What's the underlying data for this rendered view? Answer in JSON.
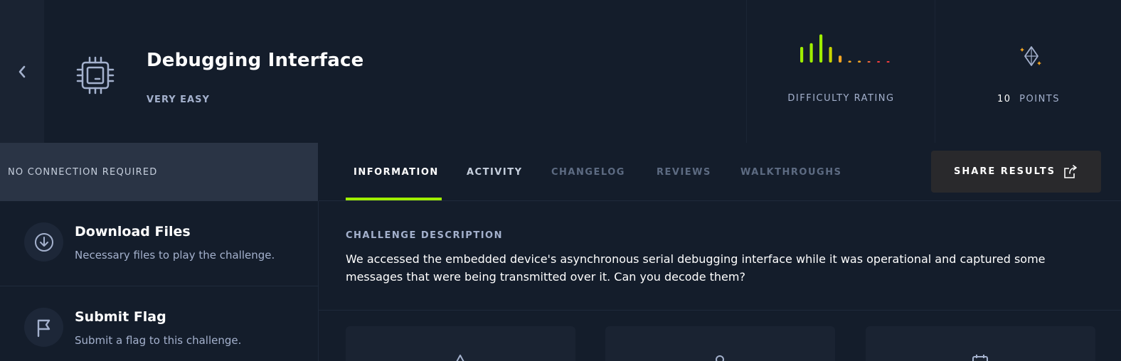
{
  "header": {
    "title": "Debugging Interface",
    "difficulty": "VERY EASY",
    "difficulty_rating_label": "DIFFICULTY RATING",
    "points_value": "10",
    "points_label": "POINTS",
    "rating_bars": [
      {
        "level": 0.5,
        "color": "#9fef00"
      },
      {
        "level": 0.62,
        "color": "#9fef00"
      },
      {
        "level": 0.9,
        "color": "#9fef00"
      },
      {
        "level": 0.5,
        "color": "#c8d400"
      },
      {
        "level": 0.22,
        "color": "#f5a623"
      },
      {
        "level": 0.06,
        "color": "#f5a623"
      },
      {
        "level": 0.06,
        "color": "#f5a623"
      },
      {
        "level": 0.04,
        "color": "#ff6a3d"
      },
      {
        "level": 0.04,
        "color": "#ff3e3e"
      },
      {
        "level": 0.04,
        "color": "#ff3e3e"
      }
    ]
  },
  "sidebar": {
    "connection": "NO CONNECTION REQUIRED",
    "download_title": "Download Files",
    "download_sub": "Necessary files to play the challenge.",
    "flag_title": "Submit Flag",
    "flag_sub": "Submit a flag to this challenge."
  },
  "tabs": {
    "information": "INFORMATION",
    "activity": "ACTIVITY",
    "changelog": "CHANGELOG",
    "reviews": "REVIEWS",
    "walkthroughs": "WALKTHROUGHS",
    "share": "SHARE RESULTS"
  },
  "content": {
    "heading": "CHALLENGE DESCRIPTION",
    "body": "We accessed the embedded device's asynchronous serial debugging interface while it was operational and captured some messages that were being transmitted over it. Can you decode them?"
  },
  "colors": {
    "accent": "#9fef00",
    "background": "#141d2b",
    "muted_text": "#a4b1cd"
  },
  "icons": [
    "chevron-left-icon",
    "chip-icon",
    "diamond-icon",
    "download-icon",
    "flag-icon",
    "share-icon",
    "warning-icon",
    "user-icon",
    "calendar-icon"
  ]
}
